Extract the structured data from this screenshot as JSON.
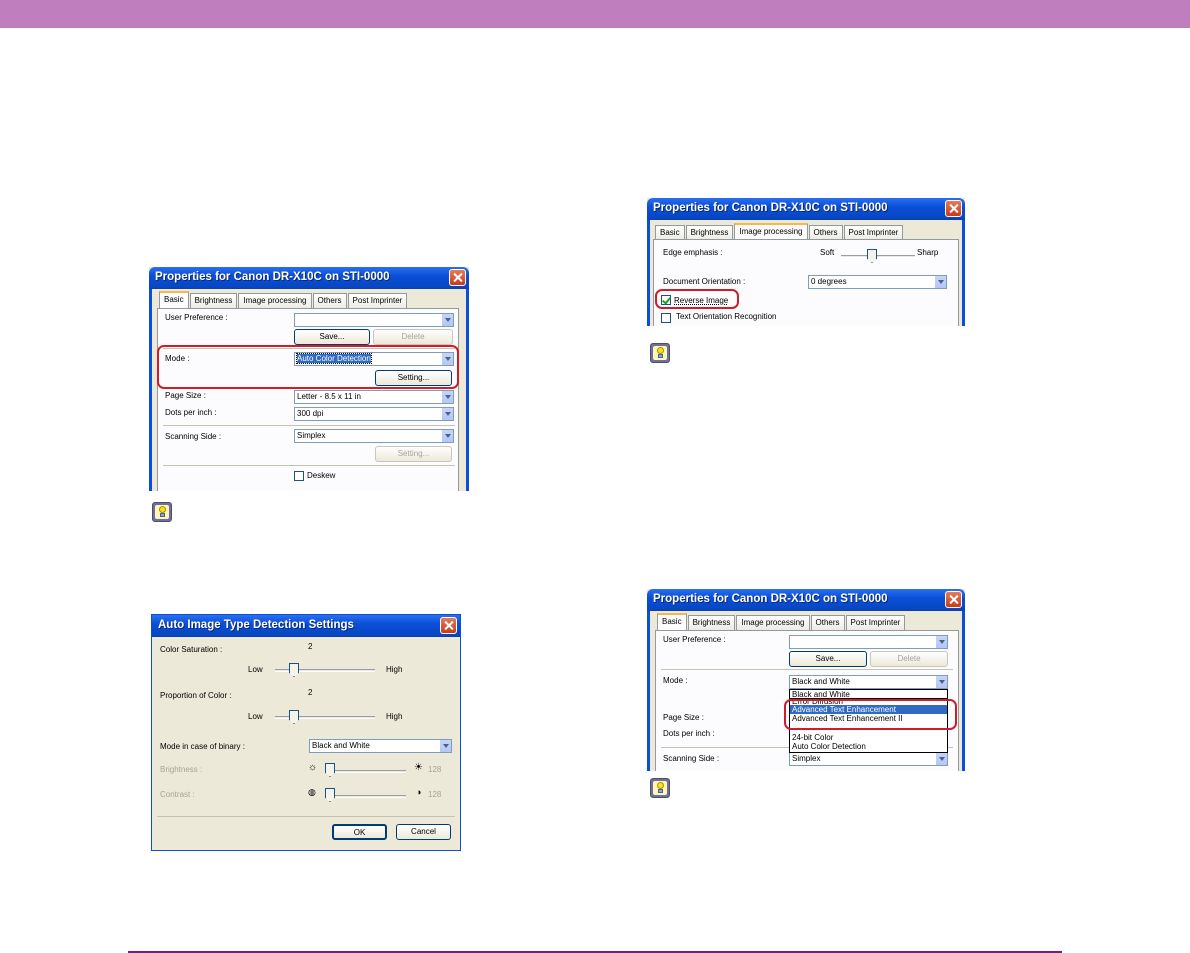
{
  "colors": {
    "header_bar": "#bf7fbf",
    "footer_rule": "#7a1f6d",
    "highlight_box": "#d21c2a",
    "xp_title": "#0b4fd8"
  },
  "dialog_basic": {
    "title": "Properties for Canon DR-X10C on STI-0000",
    "tabs": [
      "Basic",
      "Brightness",
      "Image processing",
      "Others",
      "Post Imprinter"
    ],
    "user_preference_label": "User Preference :",
    "user_preference_value": "",
    "save_label": "Save...",
    "delete_label": "Delete",
    "mode_label": "Mode :",
    "mode_value": "Auto Color Detection",
    "setting_label": "Setting...",
    "page_size_label": "Page Size :",
    "page_size_value": "Letter - 8.5 x 11 in",
    "dpi_label": "Dots per inch :",
    "dpi_value": "300 dpi",
    "scanning_side_label": "Scanning Side :",
    "scanning_side_value": "Simplex",
    "setting2_label": "Setting...",
    "deskew_label": "Deskew"
  },
  "dialog_auto": {
    "title": "Auto Image Type Detection Settings",
    "color_saturation_label": "Color Saturation :",
    "color_saturation_value": "2",
    "low_label": "Low",
    "high_label": "High",
    "proportion_label": "Proportion of Color :",
    "proportion_value": "2",
    "low2_label": "Low",
    "high2_label": "High",
    "binary_mode_label": "Mode in case of binary :",
    "binary_mode_value": "Black and White",
    "brightness_label": "Brightness :",
    "brightness_value": "128",
    "contrast_label": "Contrast :",
    "contrast_value": "128",
    "ok_label": "OK",
    "cancel_label": "Cancel"
  },
  "dialog_image": {
    "title": "Properties for Canon DR-X10C on STI-0000",
    "tabs": [
      "Basic",
      "Brightness",
      "Image processing",
      "Others",
      "Post Imprinter"
    ],
    "edge_label": "Edge emphasis :",
    "soft_label": "Soft",
    "sharp_label": "Sharp",
    "orientation_label": "Document Orientation :",
    "orientation_value": "0 degrees",
    "reverse_label": "Reverse Image",
    "text_orientation_label": "Text Orientation Recognition"
  },
  "dialog_mode": {
    "title": "Properties for Canon DR-X10C on STI-0000",
    "tabs": [
      "Basic",
      "Brightness",
      "Image processing",
      "Others",
      "Post Imprinter"
    ],
    "user_preference_label": "User Preference :",
    "user_preference_value": "",
    "save_label": "Save...",
    "delete_label": "Delete",
    "mode_label": "Mode :",
    "mode_value": "Black and White",
    "options": [
      "Black and White",
      "Error Diffusion",
      "Advanced Text Enhancement",
      "Advanced Text Enhancement II",
      "24-bit Color",
      "Auto Color Detection"
    ],
    "page_size_label": "Page Size :",
    "dpi_label": "Dots per inch :",
    "scanning_side_label": "Scanning Side :",
    "scanning_side_value": "Simplex"
  }
}
